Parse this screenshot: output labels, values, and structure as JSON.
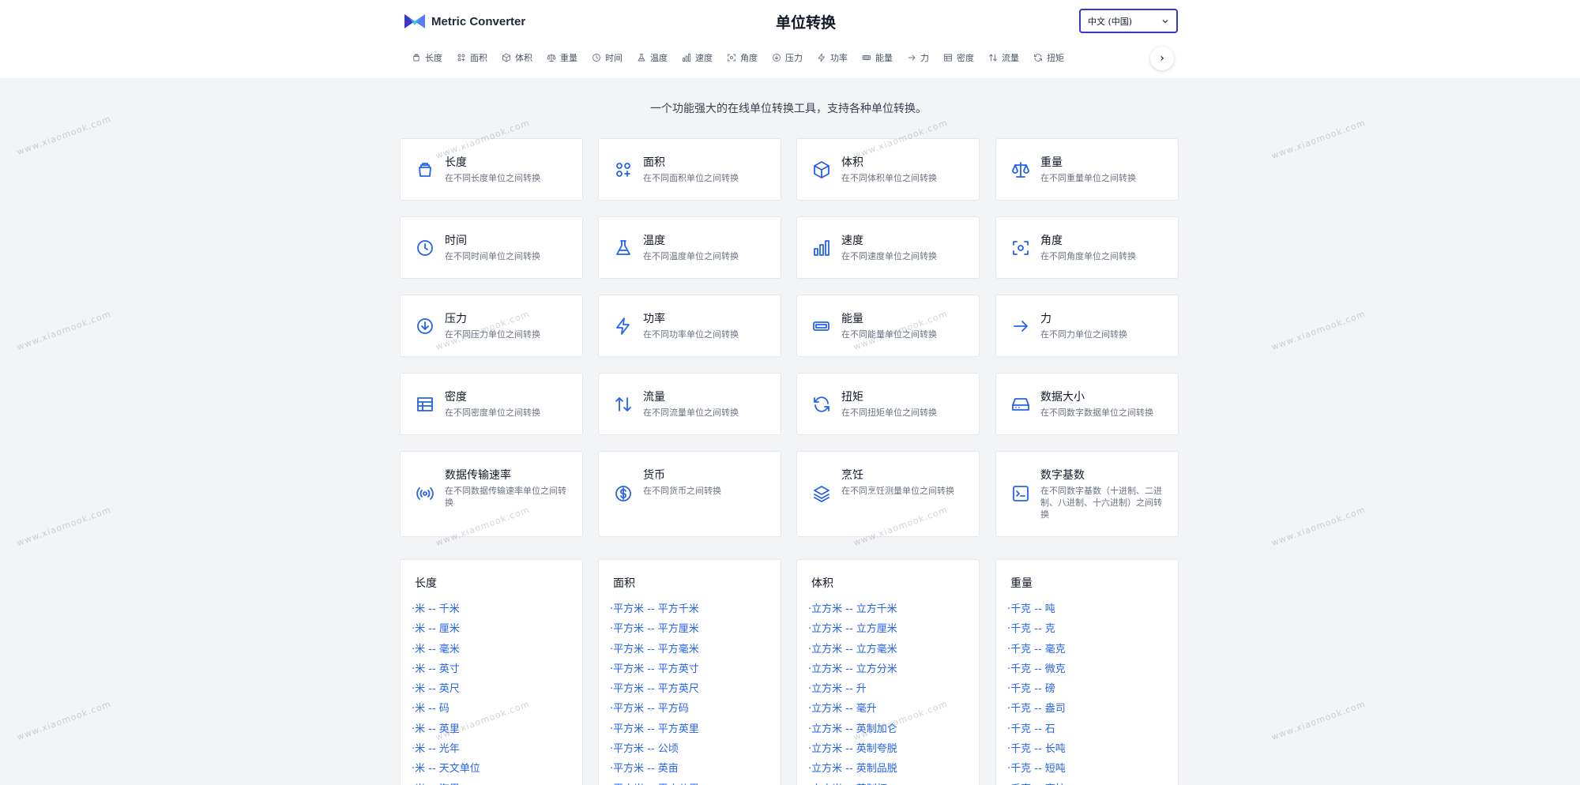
{
  "header": {
    "brand_name": "Metric Converter",
    "page_title": "单位转换",
    "language": "中文 (中国)",
    "accent_color": "#3b37c6",
    "tabs": [
      {
        "label": "长度",
        "icon": "ruler-icon"
      },
      {
        "label": "面积",
        "icon": "area-icon"
      },
      {
        "label": "体积",
        "icon": "box-icon"
      },
      {
        "label": "重量",
        "icon": "scale-icon"
      },
      {
        "label": "时间",
        "icon": "clock-icon"
      },
      {
        "label": "温度",
        "icon": "flask-icon"
      },
      {
        "label": "速度",
        "icon": "bar-chart-icon"
      },
      {
        "label": "角度",
        "icon": "focus-icon"
      },
      {
        "label": "压力",
        "icon": "arrow-down-circle-icon"
      },
      {
        "label": "功率",
        "icon": "bolt-icon"
      },
      {
        "label": "能量",
        "icon": "battery-icon"
      },
      {
        "label": "力",
        "icon": "arrow-right-icon"
      },
      {
        "label": "密度",
        "icon": "table-icon"
      },
      {
        "label": "流量",
        "icon": "arrows-updown-icon"
      },
      {
        "label": "扭矩",
        "icon": "refresh-icon"
      }
    ],
    "next_glyph": "›"
  },
  "intro": "一个功能强大的在线单位转换工具，支持各种单位转换。",
  "categories": [
    {
      "title": "长度",
      "desc": "在不同长度单位之间转换",
      "icon": "ruler-icon"
    },
    {
      "title": "面积",
      "desc": "在不同面积单位之间转换",
      "icon": "area-icon"
    },
    {
      "title": "体积",
      "desc": "在不同体积单位之间转换",
      "icon": "box-icon"
    },
    {
      "title": "重量",
      "desc": "在不同重量单位之间转换",
      "icon": "scale-icon"
    },
    {
      "title": "时间",
      "desc": "在不同时间单位之间转换",
      "icon": "clock-icon"
    },
    {
      "title": "温度",
      "desc": "在不同温度单位之间转换",
      "icon": "flask-icon"
    },
    {
      "title": "速度",
      "desc": "在不同速度单位之间转换",
      "icon": "bar-chart-icon"
    },
    {
      "title": "角度",
      "desc": "在不同角度单位之间转换",
      "icon": "focus-icon"
    },
    {
      "title": "压力",
      "desc": "在不同压力单位之间转换",
      "icon": "arrow-down-circle-icon"
    },
    {
      "title": "功率",
      "desc": "在不同功率单位之间转换",
      "icon": "bolt-icon"
    },
    {
      "title": "能量",
      "desc": "在不同能量单位之间转换",
      "icon": "battery-icon"
    },
    {
      "title": "力",
      "desc": "在不同力单位之间转换",
      "icon": "arrow-right-icon"
    },
    {
      "title": "密度",
      "desc": "在不同密度单位之间转换",
      "icon": "table-icon"
    },
    {
      "title": "流量",
      "desc": "在不同流量单位之间转换",
      "icon": "arrows-updown-icon"
    },
    {
      "title": "扭矩",
      "desc": "在不同扭矩单位之间转换",
      "icon": "refresh-icon"
    },
    {
      "title": "数据大小",
      "desc": "在不同数字数据单位之间转换",
      "icon": "hard-drive-icon"
    },
    {
      "title": "数据传输速率",
      "desc": "在不同数据传输速率单位之间转换",
      "icon": "radio-icon"
    },
    {
      "title": "货币",
      "desc": "在不同货币之间转换",
      "icon": "dollar-icon"
    },
    {
      "title": "烹饪",
      "desc": "在不同烹饪测量单位之间转换",
      "icon": "layers-icon"
    },
    {
      "title": "数字基数",
      "desc": "在不同数字基数（十进制、二进制、八进制、十六进制）之间转换",
      "icon": "terminal-icon"
    }
  ],
  "lists": [
    {
      "title": "长度",
      "links": [
        "·米 -- 千米",
        "·米 -- 厘米",
        "·米 -- 毫米",
        "·米 -- 英寸",
        "·米 -- 英尺",
        "·米 -- 码",
        "·米 -- 英里",
        "·米 -- 光年",
        "·米 -- 天文单位",
        "·米 -- 海里"
      ]
    },
    {
      "title": "面积",
      "links": [
        "·平方米 -- 平方千米",
        "·平方米 -- 平方厘米",
        "·平方米 -- 平方毫米",
        "·平方米 -- 平方英寸",
        "·平方米 -- 平方英尺",
        "·平方米 -- 平方码",
        "·平方米 -- 平方英里",
        "·平方米 -- 公顷",
        "·平方米 -- 英亩",
        "·平方米 -- 平方公里"
      ]
    },
    {
      "title": "体积",
      "links": [
        "·立方米 -- 立方千米",
        "·立方米 -- 立方厘米",
        "·立方米 -- 立方毫米",
        "·立方米 -- 立方分米",
        "·立方米 -- 升",
        "·立方米 -- 毫升",
        "·立方米 -- 英制加仑",
        "·立方米 -- 英制夸脱",
        "·立方米 -- 英制品脱",
        "·立方米 -- 英制杯"
      ]
    },
    {
      "title": "重量",
      "links": [
        "·千克 -- 吨",
        "·千克 -- 克",
        "·千克 -- 毫克",
        "·千克 -- 微克",
        "·千克 -- 磅",
        "·千克 -- 盎司",
        "·千克 -- 石",
        "·千克 -- 长吨",
        "·千克 -- 短吨",
        "·千克 -- 克拉"
      ]
    }
  ],
  "watermark": "www.xiaomook.com"
}
